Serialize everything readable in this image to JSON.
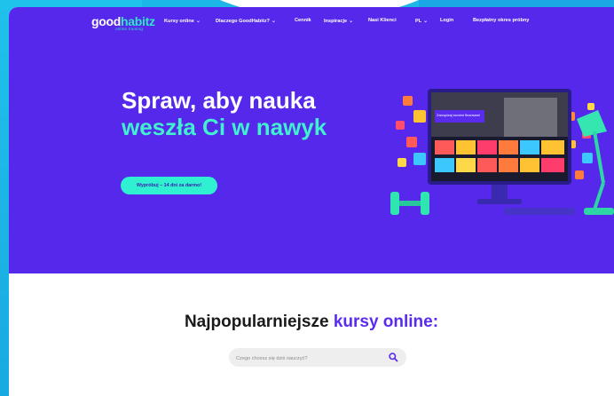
{
  "colors": {
    "hero_bg": "#5528eb",
    "accent_teal": "#2ff0d0",
    "accent_purple": "#5a2bef",
    "outer_bg": "#1bb7e6"
  },
  "brand": {
    "logo_part1": "good",
    "logo_part2": "habitz",
    "logo_tagline": "online training"
  },
  "nav": {
    "items": [
      {
        "label": "Kursy online",
        "dropdown": true
      },
      {
        "label": "Dlaczego GoodHabitz?",
        "dropdown": true
      },
      {
        "label": "Cennik",
        "dropdown": false
      },
      {
        "label": "Inspiracje",
        "dropdown": true
      },
      {
        "label": "Nasi Klienci",
        "dropdown": false
      },
      {
        "label": "PL",
        "dropdown": true
      },
      {
        "label": "Login",
        "dropdown": false
      },
      {
        "label": "Bezpłatny okres próbny",
        "dropdown": false
      }
    ]
  },
  "hero": {
    "headline_line1": "Spraw, aby nauka",
    "headline_line2": "weszła Ci w nawyk",
    "cta_label": "Wypróbuj – 14 dni za darmo!",
    "screen_text": "Zarządzaj swoimi finansami osobistymi"
  },
  "popular": {
    "title_part1": "Najpopularniejsze ",
    "title_part2": "kursy online:",
    "search_placeholder": "Czego chcesz się dziś nauczyć?",
    "search_icon": "search-icon"
  },
  "icons": [
    "chevron-down-icon",
    "search-icon",
    "lamp-icon",
    "dumbbell-icon",
    "monitor-icon"
  ]
}
